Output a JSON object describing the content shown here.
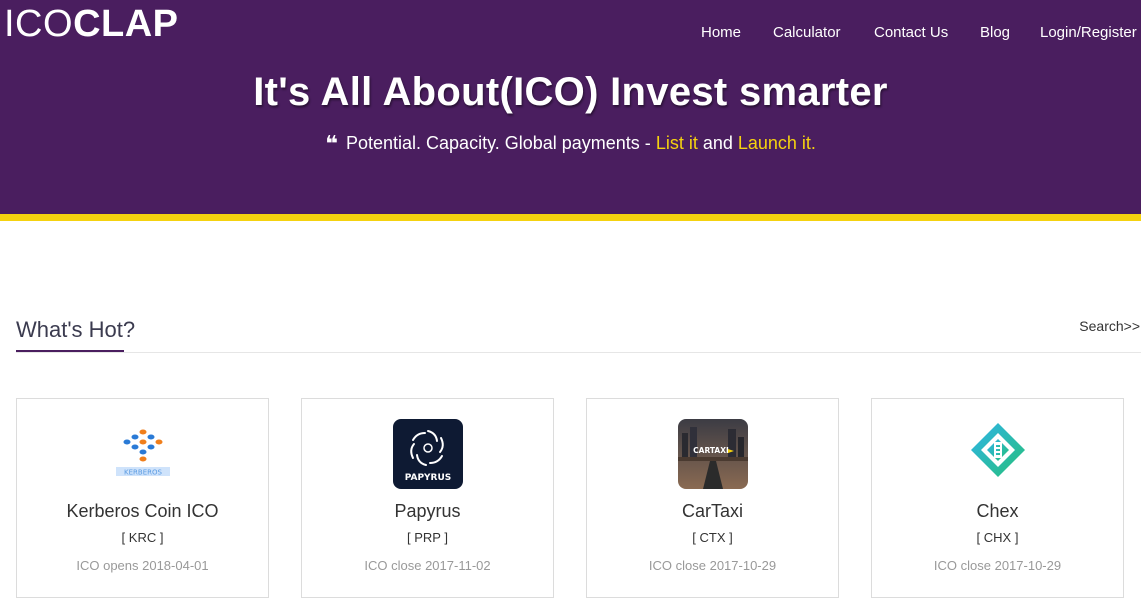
{
  "brand": {
    "thin": "ICO",
    "bold": "CLAP"
  },
  "nav": {
    "items": [
      "Home",
      "Calculator",
      "Contact Us",
      "Blog",
      "Login/Register"
    ]
  },
  "hero": {
    "title": "It's All About(ICO) Invest smarter",
    "quote_icon": "quote-icon",
    "sub_prefix": "Potential. Capacity. Global payments - ",
    "list_link": "List it",
    "and_text": " and ",
    "launch_link": "Launch it."
  },
  "section": {
    "title": "What's Hot?",
    "search_label": "Search>>"
  },
  "cards": [
    {
      "name": "Kerberos Coin ICO",
      "symbol": "[ KRC ]",
      "status": "ICO opens 2018-04-01",
      "logo_text": "KERBEROS"
    },
    {
      "name": "Papyrus",
      "symbol": "[ PRP ]",
      "status": "ICO close 2017-11-02",
      "logo_text": "PAPYRUS"
    },
    {
      "name": "CarTaxi",
      "symbol": "[ CTX ]",
      "status": "ICO close 2017-10-29",
      "logo_text": "CARTAXI"
    },
    {
      "name": "Chex",
      "symbol": "[ CHX ]",
      "status": "ICO close 2017-10-29"
    }
  ],
  "colors": {
    "header_bg": "#4a1e5f",
    "accent_yellow": "#f5d20f"
  }
}
